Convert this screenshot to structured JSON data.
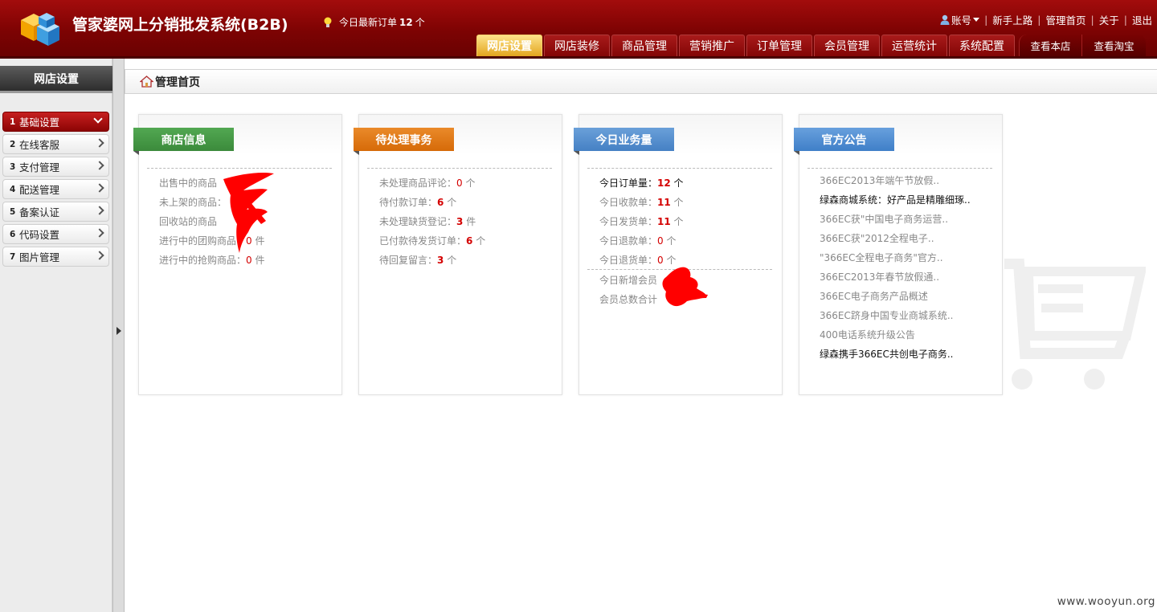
{
  "app": {
    "title": "管家婆网上分销批发系统(B2B)",
    "notice_prefix": "今日最新订单",
    "notice_count": "12",
    "notice_suffix": "个"
  },
  "toplinks": {
    "account": "账号",
    "guide": "新手上路",
    "admin_home": "管理首页",
    "about": "关于",
    "logout": "退出",
    "separator": "|"
  },
  "nav": {
    "tabs": [
      {
        "label": "网店设置"
      },
      {
        "label": "网店装修"
      },
      {
        "label": "商品管理"
      },
      {
        "label": "营销推广"
      },
      {
        "label": "订单管理"
      },
      {
        "label": "会员管理"
      },
      {
        "label": "运营统计"
      },
      {
        "label": "系统配置"
      }
    ],
    "right": [
      {
        "label": "查看本店"
      },
      {
        "label": "查看淘宝"
      }
    ]
  },
  "sidebar": {
    "title": "网店设置",
    "items": [
      {
        "num": "1",
        "label": "基础设置"
      },
      {
        "num": "2",
        "label": "在线客服"
      },
      {
        "num": "3",
        "label": "支付管理"
      },
      {
        "num": "4",
        "label": "配送管理"
      },
      {
        "num": "5",
        "label": "备案认证"
      },
      {
        "num": "6",
        "label": "代码设置"
      },
      {
        "num": "7",
        "label": "图片管理"
      }
    ]
  },
  "breadcrumb": {
    "label": "管理首页"
  },
  "shop_info": {
    "title": "商店信息",
    "rows": [
      {
        "label": "出售中的商品"
      },
      {
        "label": "未上架的商品："
      },
      {
        "label": "回收站的商品"
      },
      {
        "label": "进行中的团购商品：",
        "value": "0",
        "unit": " 件"
      },
      {
        "label": "进行中的抢购商品：",
        "value": "0",
        "unit": " 件"
      }
    ]
  },
  "pending": {
    "title": "待处理事务",
    "rows": [
      {
        "label": "未处理商品评论：",
        "value": "0",
        "unit": " 个"
      },
      {
        "label": "待付款订单：",
        "value": "6",
        "unit": " 个"
      },
      {
        "label": "未处理缺货登记：",
        "value": "3",
        "unit": " 件"
      },
      {
        "label": "已付款待发货订单：",
        "value": "6",
        "unit": " 个"
      },
      {
        "label": "待回复留言：",
        "value": "3",
        "unit": " 个"
      }
    ]
  },
  "today": {
    "title": "今日业务量",
    "rows": [
      {
        "label": "今日订单量：",
        "value": "12",
        "unit": " 个"
      },
      {
        "label": "今日收款单：",
        "value": "11",
        "unit": " 个"
      },
      {
        "label": "今日发货单：",
        "value": "11",
        "unit": " 个"
      },
      {
        "label": "今日退款单：",
        "value": "0",
        "unit": " 个"
      },
      {
        "label": "今日退货单：",
        "value": "0",
        "unit": " 个"
      }
    ],
    "members": [
      {
        "label": "今日新增会员"
      },
      {
        "label": "会员总数合计"
      }
    ]
  },
  "announcements": {
    "title": "官方公告",
    "items": [
      "366EC2013年端午节放假..",
      "绿森商城系统：好产品是精雕细琢..",
      "366EC获\"中国电子商务运营..",
      "366EC获\"2012全程电子..",
      "\"366EC全程电子商务\"官方..",
      "366EC2013年春节放假通..",
      "366EC电子商务产品概述",
      "366EC跻身中国专业商城系统..",
      "400电话系统升级公告",
      "绿森携手366EC共创电子商务.."
    ]
  },
  "watermark": "www.wooyun.org",
  "colors": {
    "header_red": "#8b0505",
    "active_tab": "#e8b030",
    "value_red": "#d40000",
    "ribbon_green": "#46994a",
    "ribbon_orange": "#e07818",
    "ribbon_blue": "#4f89cc"
  }
}
